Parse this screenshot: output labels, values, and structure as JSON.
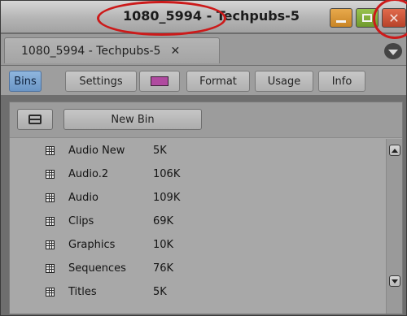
{
  "window": {
    "title": "1080_5994 - Techpubs-5",
    "controls": {
      "minimize_icon": "minimize-icon",
      "maximize_icon": "maximize-icon",
      "close_glyph": "✕"
    }
  },
  "tab": {
    "label": "1080_5994 - Techpubs-5",
    "close_glyph": "✕"
  },
  "subtabs": [
    {
      "label": "Bins",
      "active": true
    },
    {
      "label": "Settings",
      "active": false
    },
    {
      "label": "",
      "icon": "color-swatch-icon",
      "color": "#b04aa0",
      "active": false
    },
    {
      "label": "Format",
      "active": false
    },
    {
      "label": "Usage",
      "active": false
    },
    {
      "label": "Info",
      "active": false
    }
  ],
  "toolbar": {
    "view_toggle_icon": "bin-view-toggle-icon",
    "new_bin_label": "New Bin"
  },
  "bins": [
    {
      "name": "Audio New",
      "size": "5K"
    },
    {
      "name": "Audio.2",
      "size": "106K"
    },
    {
      "name": "Audio",
      "size": "109K"
    },
    {
      "name": "Clips",
      "size": "69K"
    },
    {
      "name": "Graphics",
      "size": "10K"
    },
    {
      "name": "Sequences",
      "size": "76K"
    },
    {
      "name": "Titles",
      "size": "5K"
    }
  ],
  "colors": {
    "active_tab": "#7ea6d4",
    "annotation": "#cc1a1a",
    "minimize": "#d99838",
    "maximize": "#86b040",
    "close": "#cc5a3c"
  }
}
